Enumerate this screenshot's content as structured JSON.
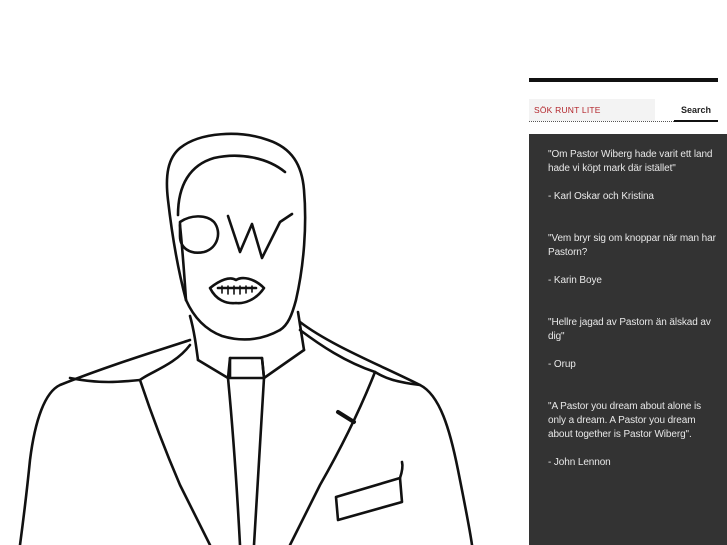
{
  "illustration": {
    "description_icon": "line-art-portrait",
    "stroke_color": "#111111"
  },
  "search": {
    "placeholder": "SÖK RUNT LITE",
    "value": "",
    "button_label": "Search",
    "accent_color": "#b3262c"
  },
  "quotes": [
    {
      "text": "\"Om Pastor Wiberg hade varit ett land hade vi köpt mark där istället\"",
      "author": "- Karl Oskar och Kristina"
    },
    {
      "text": "\"Vem bryr sig om knoppar när man har Pastorn?",
      "author": "- Karin Boye"
    },
    {
      "text": "\"Hellre jagad av Pastorn än älskad av dig\"",
      "author": "- Orup"
    },
    {
      "text": "\"A Pastor you dream about alone is only a dream. A Pastor you dream about together is Pastor Wiberg\".",
      "author": "- John Lennon"
    }
  ],
  "colors": {
    "panel_bg": "#333333",
    "panel_text": "#e8e8e8",
    "rule": "#111111"
  }
}
